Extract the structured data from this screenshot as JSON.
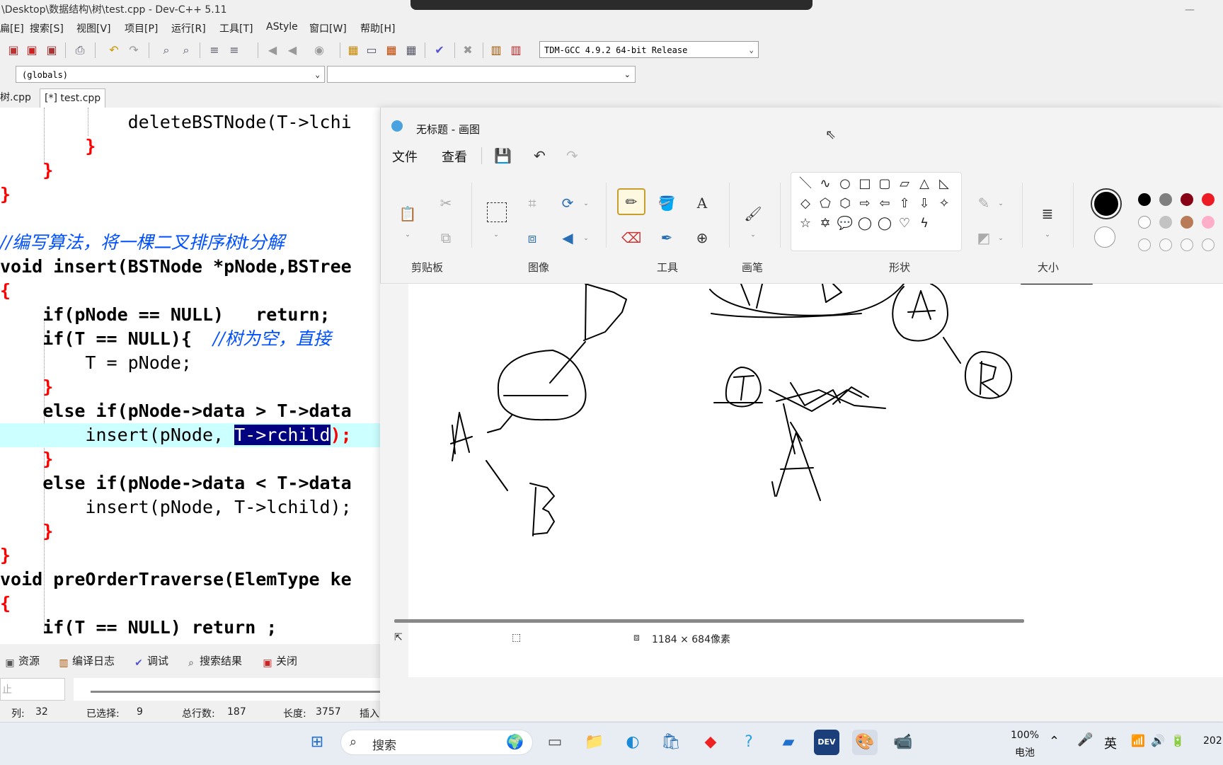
{
  "devcpp": {
    "title": "\\Desktop\\数据结构\\树\\test.cpp - Dev-C++ 5.11",
    "menu": [
      "扁[E]",
      "搜索[S]",
      "视图[V]",
      "项目[P]",
      "运行[R]",
      "工具[T]",
      "AStyle",
      "窗口[W]",
      "帮助[H]"
    ],
    "compiler": "TDM-GCC 4.9.2 64-bit Release",
    "scope": "(globals)",
    "tabs": [
      "树.cpp",
      "[*] test.cpp"
    ],
    "code": {
      "l1": "deleteBSTNode(T->lchi",
      "l5_comment": "//编写算法，将一棵二叉排序树t分解",
      "l6": "void insert(BSTNode *pNode,BSTree",
      "l8a": "if(pNode == NULL)",
      "l8b": "return;",
      "l9a": "if(T == NULL){",
      "l9c": "//树为空，直接",
      "l10": "T = pNode;",
      "l12": "else if(pNode->data > T->data",
      "l13a": "insert(pNode, ",
      "l13sel": "T->rchild",
      "l13b": ");",
      "l15": "else if(pNode->data < T->data",
      "l16": "insert(pNode, T->lchild);",
      "l18": "void preOrderTraverse(ElemType ke",
      "l20": "if(T == NULL) return ;"
    },
    "bottom_tabs": [
      "资源",
      "编译日志",
      "调试",
      "搜索结果",
      "关闭"
    ],
    "stop_label": "止",
    "status": {
      "col_label": "列:",
      "col": "32",
      "sel_label": "已选择:",
      "sel": "9",
      "lines_label": "总行数:",
      "lines": "187",
      "len_label": "长度:",
      "len": "3757",
      "mode": "插入"
    }
  },
  "paint": {
    "title": "无标题 - 画图",
    "menu": [
      "文件",
      "查看"
    ],
    "groups": [
      "剪贴板",
      "图像",
      "工具",
      "画笔",
      "形状",
      "大小"
    ],
    "canvas_size": "1184 × 684像素",
    "colors": [
      "#000000",
      "#7f7f7f",
      "#880015",
      "#ed1c24",
      "#ffffff",
      "#c3c3c3",
      "#b97a57",
      "#ffaec9"
    ]
  },
  "taskbar": {
    "search_placeholder": "搜索",
    "battery_pct": "100%",
    "battery_label": "电池",
    "ime": "英",
    "clock": "202"
  }
}
